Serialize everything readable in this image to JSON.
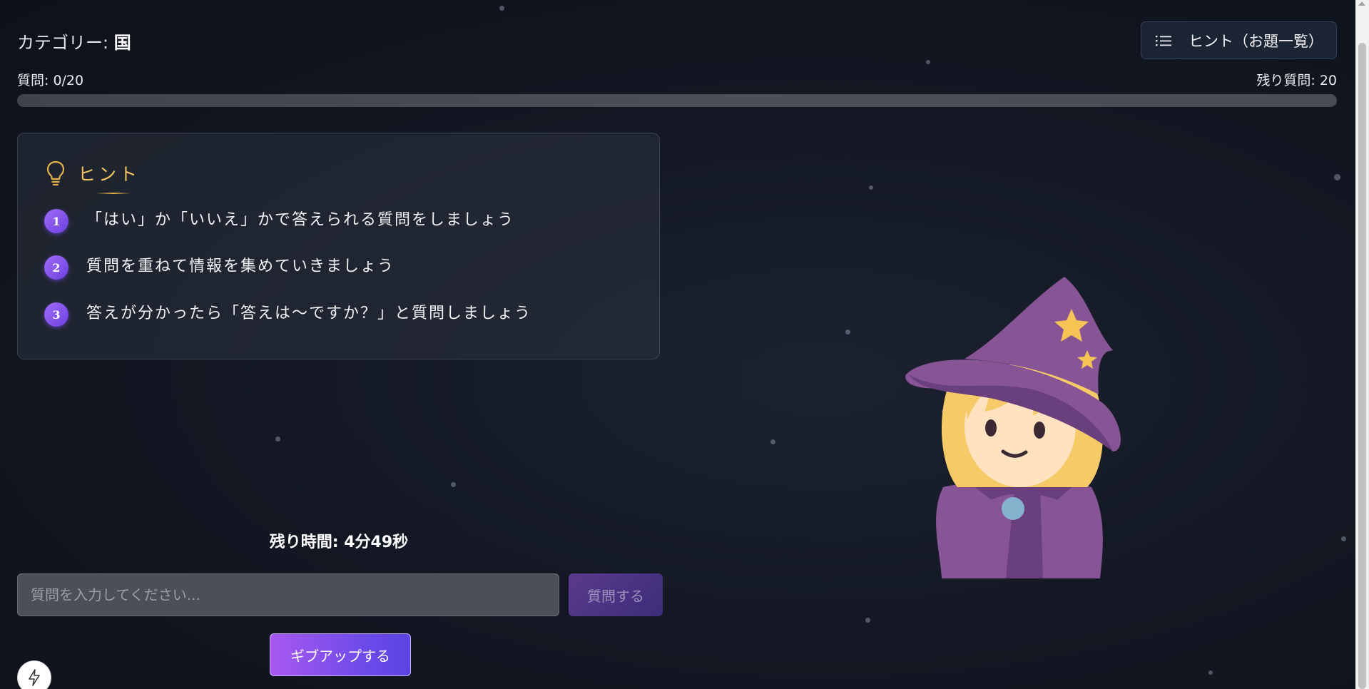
{
  "header": {
    "category_label": "カテゴリー:",
    "category_value": "国",
    "hint_list_button_label": "ヒント（お題一覧）"
  },
  "progress": {
    "questions_label": "質問: 0/20",
    "remaining_label": "残り質問: 20",
    "asked": 0,
    "total": 20
  },
  "hints": {
    "title": "ヒント",
    "items": [
      {
        "number": "1",
        "text": "「はい」か「いいえ」かで答えられる質問をしましょう"
      },
      {
        "number": "2",
        "text": "質問を重ねて情報を集めていきましょう"
      },
      {
        "number": "3",
        "text": "答えが分かったら「答えは〜ですか？」と質問しましょう"
      }
    ]
  },
  "timer": {
    "label": "残り時間: 4分49秒"
  },
  "question_input": {
    "placeholder": "質問を入力してください...",
    "value": ""
  },
  "buttons": {
    "ask": "質問する",
    "give_up": "ギブアップする"
  },
  "icons": {
    "hint_list": "list-icon",
    "bulb": "lightbulb-icon",
    "bolt": "lightning-icon",
    "character": "witch-character"
  },
  "colors": {
    "accent_purple": "#8b5cf6",
    "hint_title_gold": "#f3c460",
    "background": "#131824"
  }
}
